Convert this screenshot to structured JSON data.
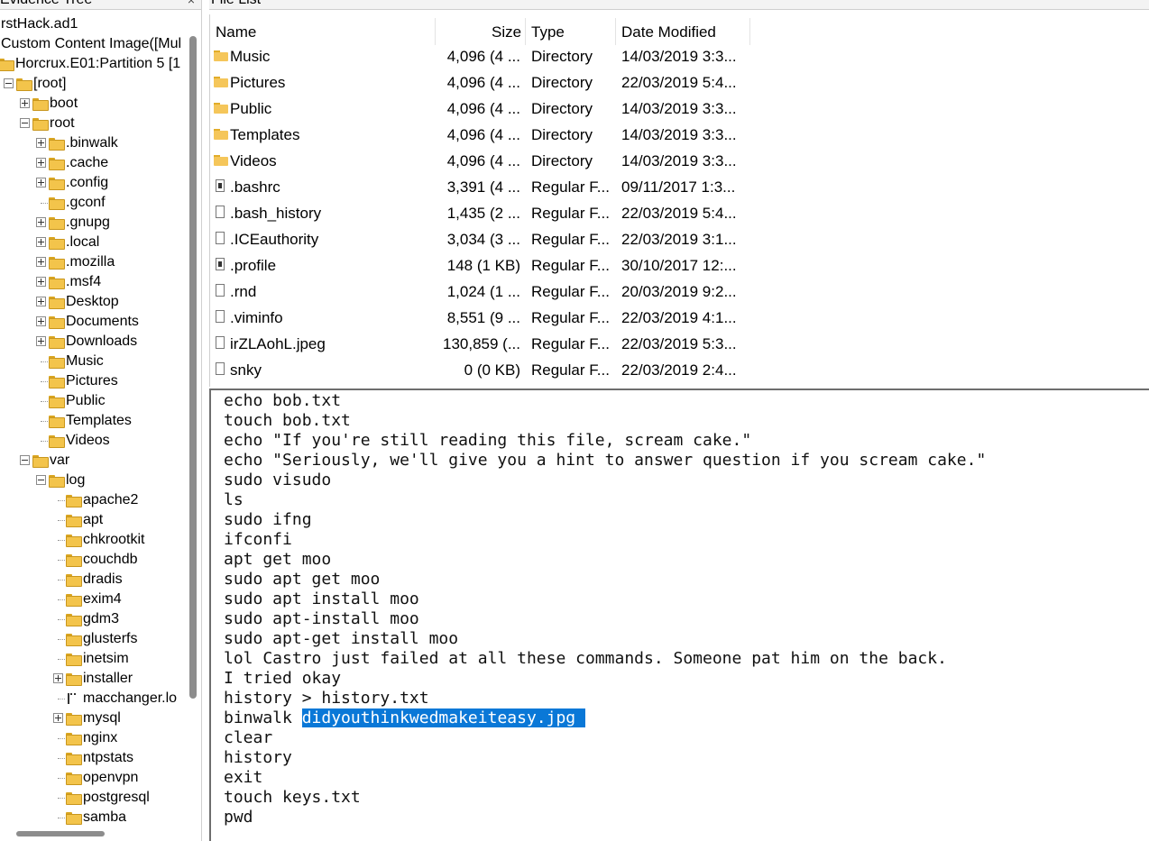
{
  "left_panel": {
    "title": "Evidence Tree",
    "close_glyph": "×",
    "tree": [
      {
        "label": "rstHack.ad1",
        "depth": 0,
        "toggle": "none",
        "folder": false
      },
      {
        "label": "Custom Content Image([Mul",
        "depth": 0,
        "toggle": "none",
        "folder": false
      },
      {
        "label": "Horcrux.E01:Partition 5 [1",
        "depth": 0,
        "toggle": "none",
        "folder": true
      },
      {
        "label": "[root]",
        "depth": 1,
        "toggle": "minus",
        "folder": true
      },
      {
        "label": "boot",
        "depth": 2,
        "toggle": "plus",
        "folder": true
      },
      {
        "label": "root",
        "depth": 2,
        "toggle": "minus",
        "folder": true
      },
      {
        "label": ".binwalk",
        "depth": 3,
        "toggle": "plus",
        "folder": true
      },
      {
        "label": ".cache",
        "depth": 3,
        "toggle": "plus",
        "folder": true
      },
      {
        "label": ".config",
        "depth": 3,
        "toggle": "plus",
        "folder": true
      },
      {
        "label": ".gconf",
        "depth": 3,
        "toggle": "none",
        "folder": true
      },
      {
        "label": ".gnupg",
        "depth": 3,
        "toggle": "plus",
        "folder": true
      },
      {
        "label": ".local",
        "depth": 3,
        "toggle": "plus",
        "folder": true
      },
      {
        "label": ".mozilla",
        "depth": 3,
        "toggle": "plus",
        "folder": true
      },
      {
        "label": ".msf4",
        "depth": 3,
        "toggle": "plus",
        "folder": true
      },
      {
        "label": "Desktop",
        "depth": 3,
        "toggle": "plus",
        "folder": true
      },
      {
        "label": "Documents",
        "depth": 3,
        "toggle": "plus",
        "folder": true
      },
      {
        "label": "Downloads",
        "depth": 3,
        "toggle": "plus",
        "folder": true
      },
      {
        "label": "Music",
        "depth": 3,
        "toggle": "none",
        "folder": true
      },
      {
        "label": "Pictures",
        "depth": 3,
        "toggle": "none",
        "folder": true
      },
      {
        "label": "Public",
        "depth": 3,
        "toggle": "none",
        "folder": true
      },
      {
        "label": "Templates",
        "depth": 3,
        "toggle": "none",
        "folder": true
      },
      {
        "label": "Videos",
        "depth": 3,
        "toggle": "none",
        "folder": true
      },
      {
        "label": "var",
        "depth": 2,
        "toggle": "minus",
        "folder": true
      },
      {
        "label": "log",
        "depth": 3,
        "toggle": "minus",
        "folder": true
      },
      {
        "label": "apache2",
        "depth": 4,
        "toggle": "none",
        "folder": true
      },
      {
        "label": "apt",
        "depth": 4,
        "toggle": "none",
        "folder": true
      },
      {
        "label": "chkrootkit",
        "depth": 4,
        "toggle": "none",
        "folder": true
      },
      {
        "label": "couchdb",
        "depth": 4,
        "toggle": "none",
        "folder": true
      },
      {
        "label": "dradis",
        "depth": 4,
        "toggle": "none",
        "folder": true
      },
      {
        "label": "exim4",
        "depth": 4,
        "toggle": "none",
        "folder": true
      },
      {
        "label": "gdm3",
        "depth": 4,
        "toggle": "none",
        "folder": true
      },
      {
        "label": "glusterfs",
        "depth": 4,
        "toggle": "none",
        "folder": true
      },
      {
        "label": "inetsim",
        "depth": 4,
        "toggle": "none",
        "folder": true
      },
      {
        "label": "installer",
        "depth": 4,
        "toggle": "plus",
        "folder": true
      },
      {
        "label": "macchanger.lo",
        "depth": 4,
        "toggle": "none",
        "folder": false
      },
      {
        "label": "mysql",
        "depth": 4,
        "toggle": "plus",
        "folder": true
      },
      {
        "label": "nginx",
        "depth": 4,
        "toggle": "none",
        "folder": true
      },
      {
        "label": "ntpstats",
        "depth": 4,
        "toggle": "none",
        "folder": true
      },
      {
        "label": "openvpn",
        "depth": 4,
        "toggle": "none",
        "folder": true
      },
      {
        "label": "postgresql",
        "depth": 4,
        "toggle": "none",
        "folder": true
      },
      {
        "label": "samba",
        "depth": 4,
        "toggle": "none",
        "folder": true
      }
    ]
  },
  "file_list": {
    "title": "File List",
    "columns": {
      "name": "Name",
      "size": "Size",
      "type": "Type",
      "date": "Date Modified"
    },
    "rows": [
      {
        "icon": "folder",
        "name": "Music",
        "size": "4,096 (4 ...",
        "type": "Directory",
        "date": "14/03/2019 3:3..."
      },
      {
        "icon": "folder",
        "name": "Pictures",
        "size": "4,096 (4 ...",
        "type": "Directory",
        "date": "22/03/2019 5:4..."
      },
      {
        "icon": "folder",
        "name": "Public",
        "size": "4,096 (4 ...",
        "type": "Directory",
        "date": "14/03/2019 3:3..."
      },
      {
        "icon": "folder",
        "name": "Templates",
        "size": "4,096 (4 ...",
        "type": "Directory",
        "date": "14/03/2019 3:3..."
      },
      {
        "icon": "folder",
        "name": "Videos",
        "size": "4,096 (4 ...",
        "type": "Directory",
        "date": "14/03/2019 3:3..."
      },
      {
        "icon": "doc-dark",
        "name": ".bashrc",
        "size": "3,391 (4 ...",
        "type": "Regular F...",
        "date": "09/11/2017 1:3..."
      },
      {
        "icon": "doc",
        "name": ".bash_history",
        "size": "1,435 (2 ...",
        "type": "Regular F...",
        "date": "22/03/2019 5:4..."
      },
      {
        "icon": "doc",
        "name": ".ICEauthority",
        "size": "3,034 (3 ...",
        "type": "Regular F...",
        "date": "22/03/2019 3:1..."
      },
      {
        "icon": "doc-dark",
        "name": ".profile",
        "size": "148 (1 KB)",
        "type": "Regular F...",
        "date": "30/10/2017 12:..."
      },
      {
        "icon": "doc",
        "name": ".rnd",
        "size": "1,024 (1 ...",
        "type": "Regular F...",
        "date": "20/03/2019 9:2..."
      },
      {
        "icon": "doc",
        "name": ".viminfo",
        "size": "8,551 (9 ...",
        "type": "Regular F...",
        "date": "22/03/2019 4:1..."
      },
      {
        "icon": "doc",
        "name": "irZLAohL.jpeg",
        "size": "130,859 (...",
        "type": "Regular F...",
        "date": "22/03/2019 5:3..."
      },
      {
        "icon": "doc",
        "name": "snky",
        "size": "0 (0 KB)",
        "type": "Regular F...",
        "date": "22/03/2019 2:4..."
      }
    ]
  },
  "text_viewer": {
    "lines": [
      "echo bob.txt",
      "touch bob.txt",
      "echo \"If you're still reading this file, scream cake.\"",
      "echo \"Seriously, we'll give you a hint to answer question if you scream cake.\"",
      "sudo visudo",
      "ls",
      "sudo ifng",
      "ifconfi",
      "apt get moo",
      "sudo apt get moo",
      "sudo apt install moo",
      "sudo apt-install moo",
      "sudo apt-get install moo",
      "lol Castro just failed at all these commands. Someone pat him on the back.",
      "I tried okay",
      "history > history.txt",
      "binwalk ",
      "clear",
      "history",
      "exit",
      "touch keys.txt",
      "pwd"
    ],
    "highlight_line": 16,
    "highlight_text": "didyouthinkwedmakeiteasy.jpg "
  },
  "colors": {
    "highlight": "#0a78d7",
    "folder": "#f3c44b"
  }
}
